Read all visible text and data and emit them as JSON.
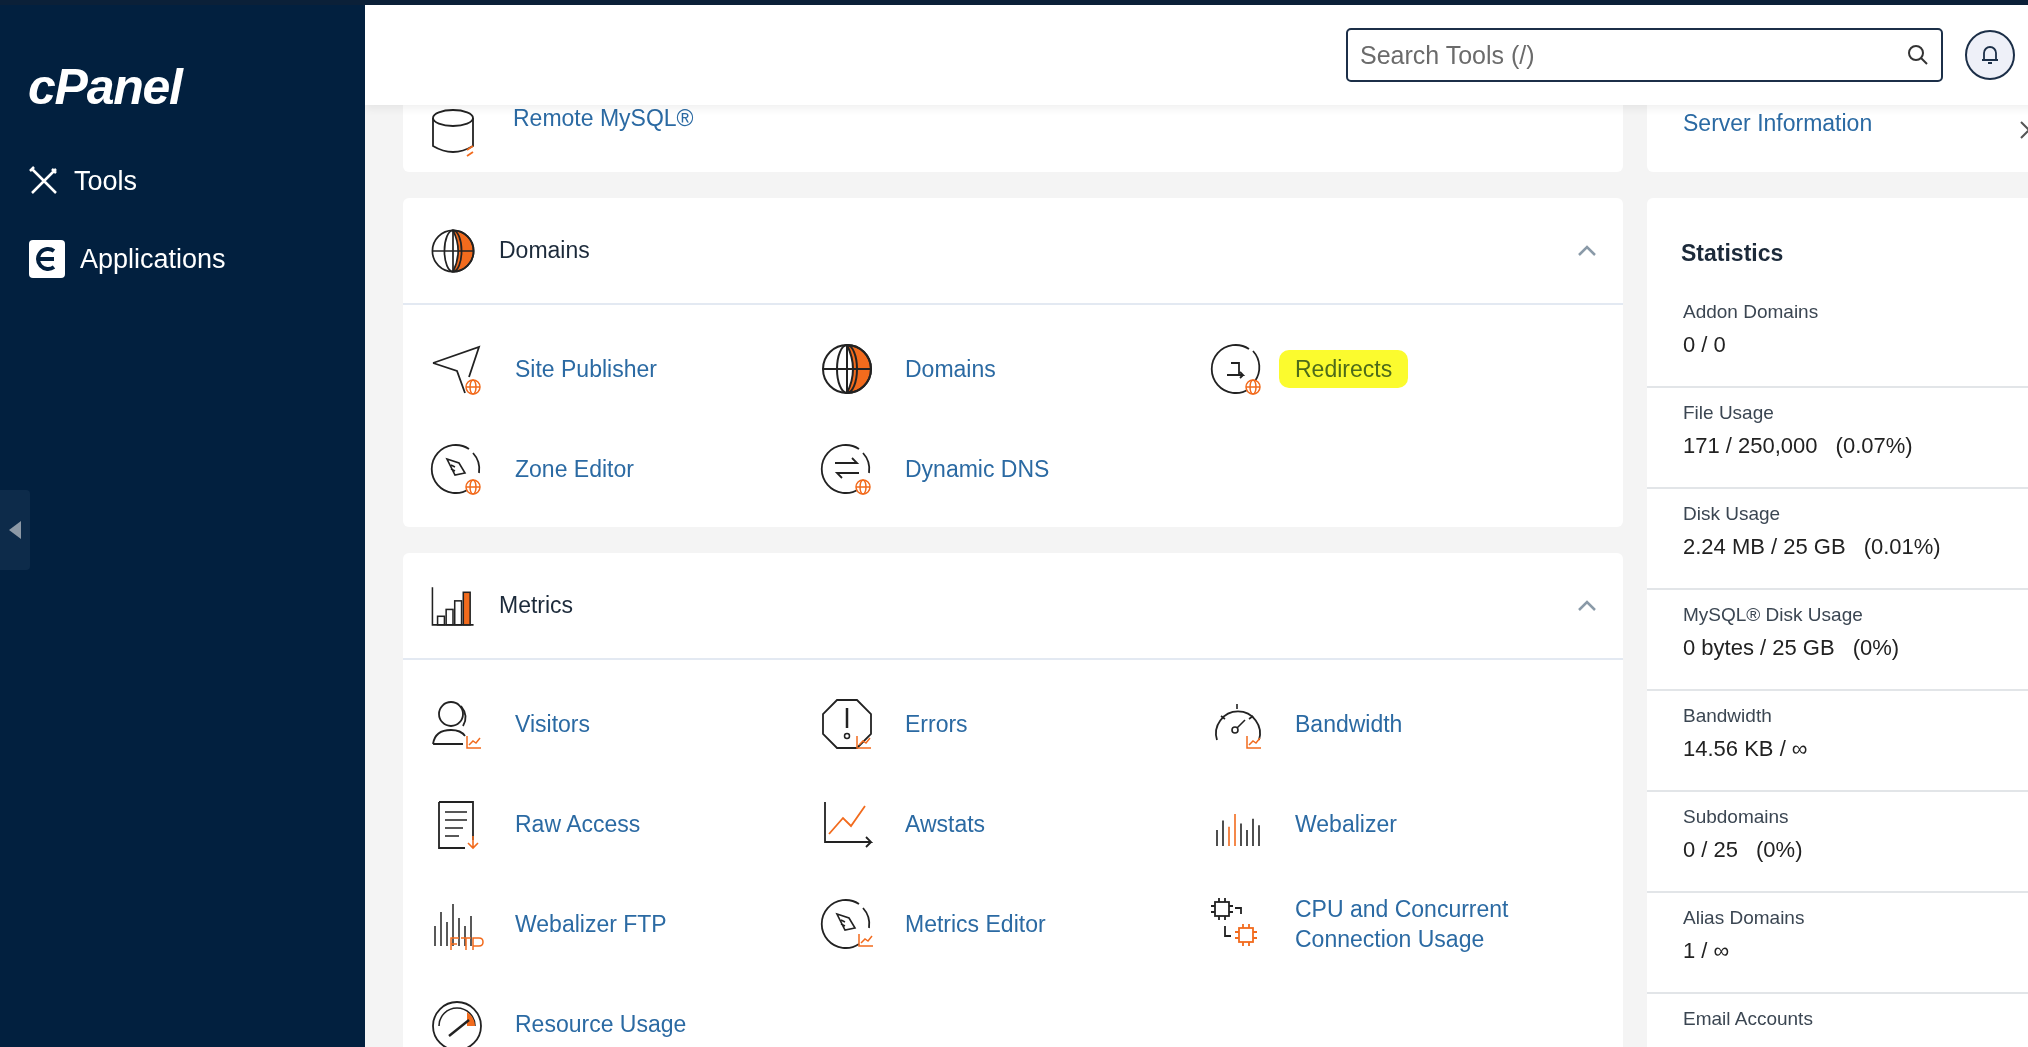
{
  "sidebar": {
    "logo": "cPanel",
    "items": [
      {
        "label": "Tools",
        "kind": "tools"
      },
      {
        "label": "Applications",
        "kind": "apps"
      }
    ]
  },
  "search": {
    "placeholder": "Search Tools (/)"
  },
  "partial_card": {
    "items": [
      {
        "label": "Remote MySQL®",
        "kind": "database"
      }
    ]
  },
  "sections": [
    {
      "title": "Domains",
      "kind": "globe",
      "expanded": true,
      "items": [
        {
          "label": "Site Publisher",
          "kind": "plane",
          "highlighted": false
        },
        {
          "label": "Domains",
          "kind": "globe",
          "highlighted": false
        },
        {
          "label": "Redirects",
          "kind": "redirect",
          "highlighted": true
        },
        {
          "label": "Zone Editor",
          "kind": "rocket",
          "highlighted": false
        },
        {
          "label": "Dynamic DNS",
          "kind": "arrows",
          "highlighted": false
        }
      ]
    },
    {
      "title": "Metrics",
      "kind": "bars",
      "expanded": true,
      "items": [
        {
          "label": "Visitors",
          "kind": "person",
          "highlighted": false
        },
        {
          "label": "Errors",
          "kind": "octagon",
          "highlighted": false
        },
        {
          "label": "Bandwidth",
          "kind": "gauge",
          "highlighted": false
        },
        {
          "label": "Raw Access",
          "kind": "document",
          "highlighted": false
        },
        {
          "label": "Awstats",
          "kind": "linechart",
          "highlighted": false
        },
        {
          "label": "Webalizer",
          "kind": "spikes",
          "highlighted": false
        },
        {
          "label": "Webalizer FTP",
          "kind": "ftp",
          "highlighted": false
        },
        {
          "label": "Metrics Editor",
          "kind": "rocketchart",
          "highlighted": false
        },
        {
          "label": "CPU and Concurrent Connection Usage",
          "kind": "chip",
          "highlighted": false
        },
        {
          "label": "Resource Usage",
          "kind": "meter",
          "highlighted": false
        }
      ]
    }
  ],
  "server_info": {
    "label": "Server Information"
  },
  "statistics": {
    "title": "Statistics",
    "rows": [
      {
        "label": "Addon Domains",
        "value": "0 / 0"
      },
      {
        "label": "File Usage",
        "value": "171 / 250,000",
        "percent": "(0.07%)"
      },
      {
        "label": "Disk Usage",
        "value": "2.24 MB / 25 GB",
        "percent": "(0.01%)"
      },
      {
        "label": "MySQL® Disk Usage",
        "value": "0 bytes / 25 GB",
        "percent": "(0%)"
      },
      {
        "label": "Bandwidth",
        "value": "14.56 KB / ∞"
      },
      {
        "label": "Subdomains",
        "value": "0 / 25",
        "percent": "(0%)"
      },
      {
        "label": "Alias Domains",
        "value": "1 / ∞"
      },
      {
        "label": "Email Accounts"
      }
    ]
  }
}
